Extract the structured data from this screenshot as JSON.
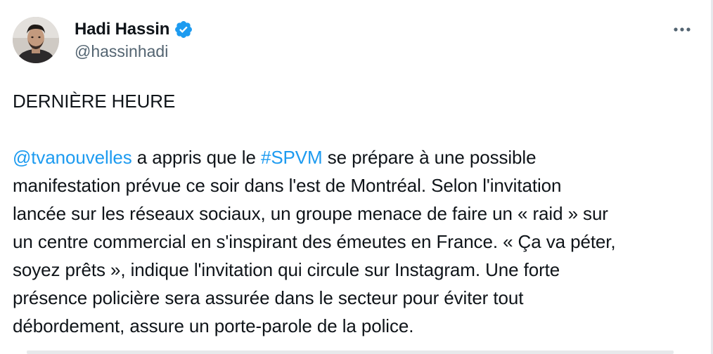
{
  "author": {
    "display_name": "Hadi Hassin",
    "handle": "@hassinhadi",
    "verified": true
  },
  "menu": {
    "more_icon": "more-horizontal-icon"
  },
  "tweet": {
    "headline": "DERNIÈRE HEURE",
    "mention": "@tvanouvelles",
    "text_after_mention": " a appris que le ",
    "hashtag": "#SPVM",
    "line1_tail": " se prépare à une possible",
    "line2": "manifestation prévue ce soir dans l'est de Montréal. Selon l'invitation",
    "line3": "lancée sur les réseaux sociaux, un groupe menace de faire un « raid » sur",
    "line4": "un centre commercial en s'inspirant des émeutes en France. « Ça va péter,",
    "line5": "soyez prêts », indique l'invitation qui circule sur Instagram. Une forte",
    "line6": "présence policière sera assurée dans le secteur pour éviter tout",
    "line7": "débordement, assure un porte-parole de la police."
  },
  "colors": {
    "link": "#1d9bf0",
    "text": "#0f1419",
    "secondary": "#536471"
  }
}
